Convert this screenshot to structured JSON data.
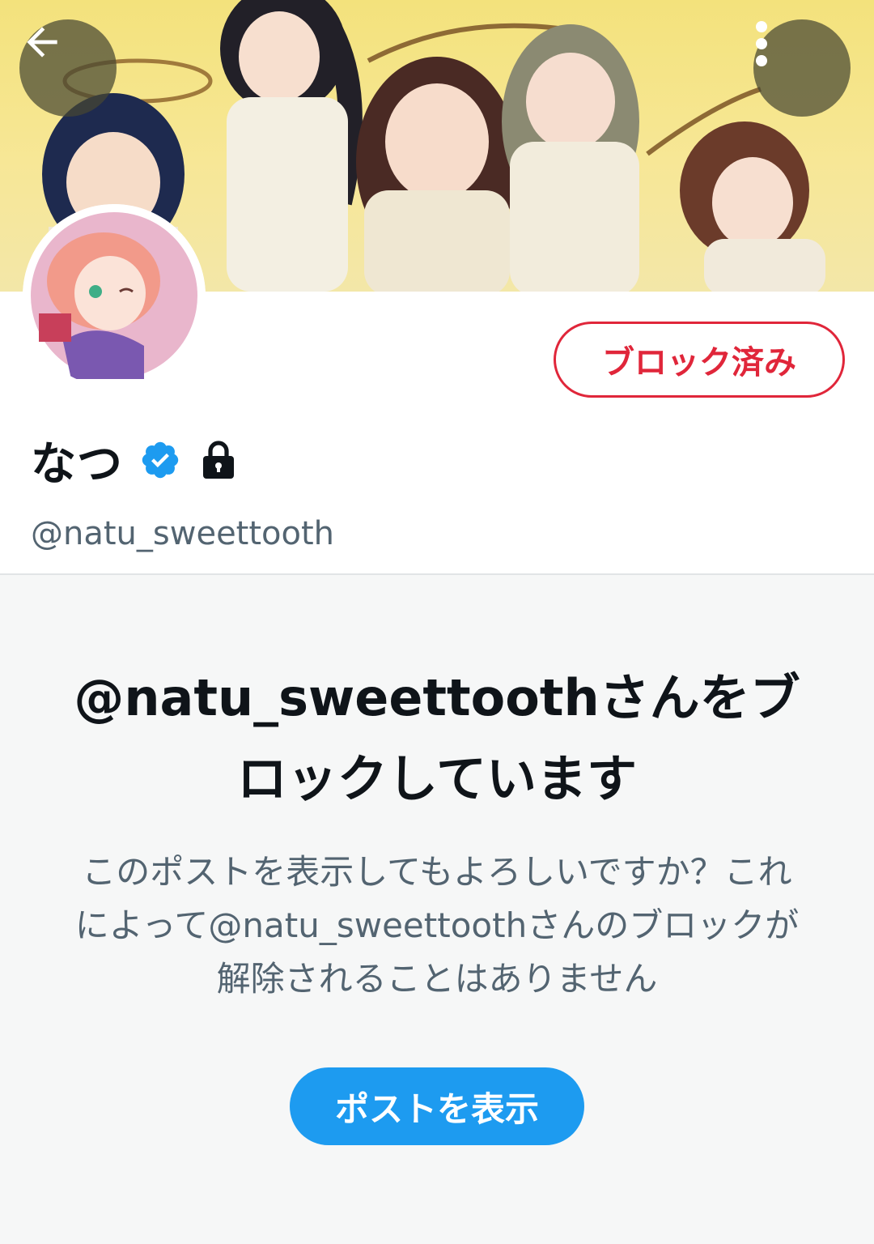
{
  "header": {
    "back_icon": "arrow-left-icon",
    "more_icon": "more-vertical-icon",
    "banner_image": "anime-group-banner"
  },
  "profile": {
    "avatar_image": "anime-avatar",
    "blocked_button_label": "ブロック済み",
    "display_name": "なつ",
    "verified_icon": "verified-badge-icon",
    "protected_icon": "lock-icon",
    "handle": "@natu_sweettooth"
  },
  "blocked_notice": {
    "title": "@natu_sweettoothさんをブロックしています",
    "description": "このポストを表示してもよろしいですか？これによって@natu_sweettoothさんのブロックが解除されることはありません",
    "show_posts_button": "ポストを表示"
  },
  "colors": {
    "accent_blue": "#1d9bf0",
    "blocked_red": "#e0263a",
    "text_primary": "#0f1419",
    "text_secondary": "#536471"
  }
}
